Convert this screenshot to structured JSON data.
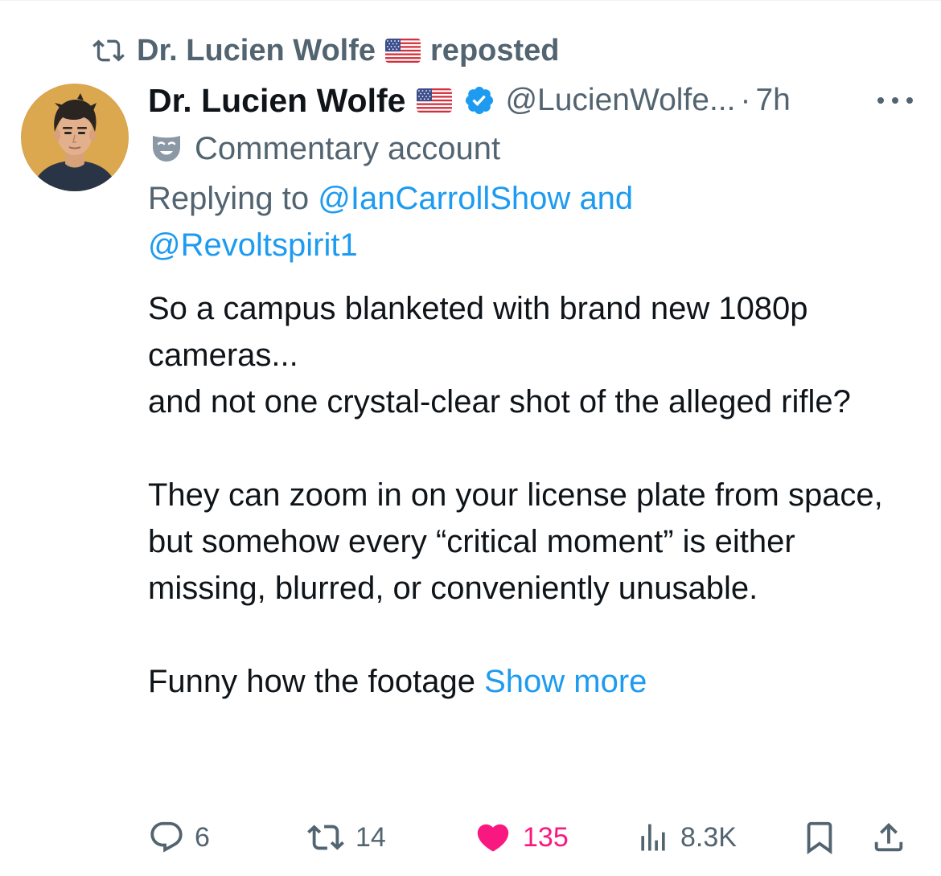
{
  "repost": {
    "reposter": "Dr. Lucien Wolfe",
    "suffix": "reposted"
  },
  "author": {
    "display_name": "Dr. Lucien Wolfe",
    "handle": "@LucienWolfe...",
    "separator": "·",
    "time": "7h",
    "verified": true
  },
  "label": {
    "text": "Commentary account"
  },
  "reply": {
    "prefix": "Replying to",
    "mention1": "@IanCarrollShow",
    "joiner": "and",
    "mention2": "@Revoltspirit1"
  },
  "tweet": {
    "p1_line1": "So a campus blanketed with brand new 1080p cameras...",
    "p1_line2": "and not one crystal-clear shot of the alleged rifle?",
    "p2_line1": "They can zoom in on your license plate from space,",
    "p2_line2": "but somehow every “critical moment” is either missing, blurred, or conveniently unusable.",
    "p3": "Funny how the footage",
    "show_more": "Show more"
  },
  "actions": {
    "replies": "6",
    "reposts": "14",
    "likes": "135",
    "views": "8.3K",
    "liked": true
  },
  "colors": {
    "text": "#0f1419",
    "muted": "#536471",
    "link": "#1d9bf0",
    "like": "#f91880",
    "verified": "#1d9bf0"
  },
  "icons": {
    "repost": "repost-icon",
    "flag": "us-flag-icon",
    "verified": "verified-badge-icon",
    "more": "more-dots-icon",
    "commentary": "theater-mask-icon",
    "reply": "reply-icon",
    "like": "heart-icon",
    "views": "views-icon",
    "bookmark": "bookmark-icon",
    "share": "share-icon"
  }
}
